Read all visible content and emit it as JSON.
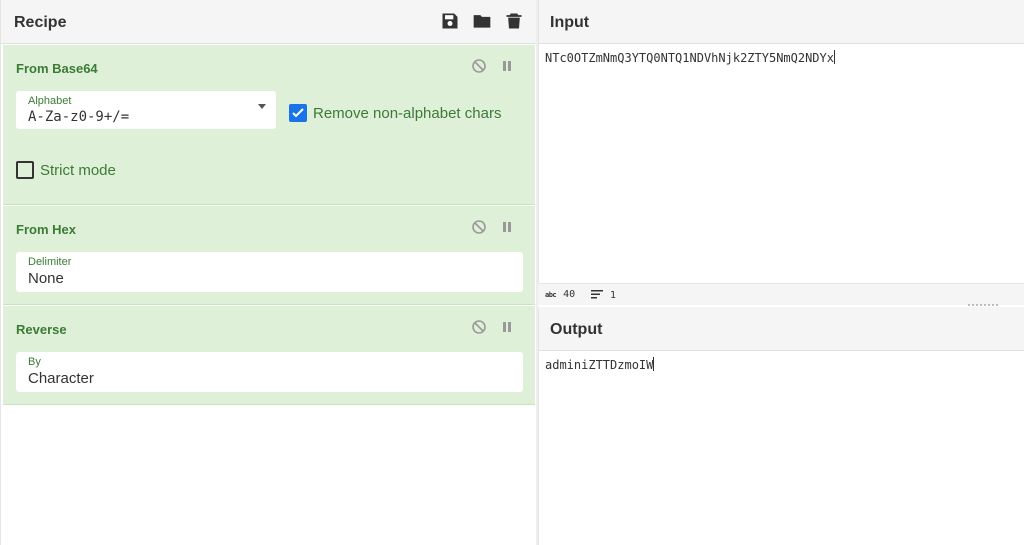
{
  "recipe": {
    "title": "Recipe",
    "actions": [
      {
        "name": "save-icon"
      },
      {
        "name": "folder-icon"
      },
      {
        "name": "trash-icon"
      }
    ],
    "operations": [
      {
        "title": "From Base64",
        "fields": [
          {
            "label": "Alphabet",
            "value": "A-Za-z0-9+/="
          }
        ],
        "checkboxes": [
          {
            "label": "Remove non-alphabet chars",
            "checked": true
          },
          {
            "label": "Strict mode",
            "checked": false
          }
        ]
      },
      {
        "title": "From Hex",
        "fields": [
          {
            "label": "Delimiter",
            "value": "None"
          }
        ]
      },
      {
        "title": "Reverse",
        "fields": [
          {
            "label": "By",
            "value": "Character"
          }
        ]
      }
    ]
  },
  "input": {
    "title": "Input",
    "text": "NTc0OTZmNmQ3YTQ0NTQ1NDVhNjk2ZTY5NmQ2NDYx",
    "status": {
      "length": "40",
      "lines": "1"
    }
  },
  "output": {
    "title": "Output",
    "text": "adminiZTTDzmoIW"
  },
  "colors": {
    "op_background": "#dff0d8",
    "op_text": "#3c7a36",
    "checkbox_on": "#1a73e8"
  }
}
